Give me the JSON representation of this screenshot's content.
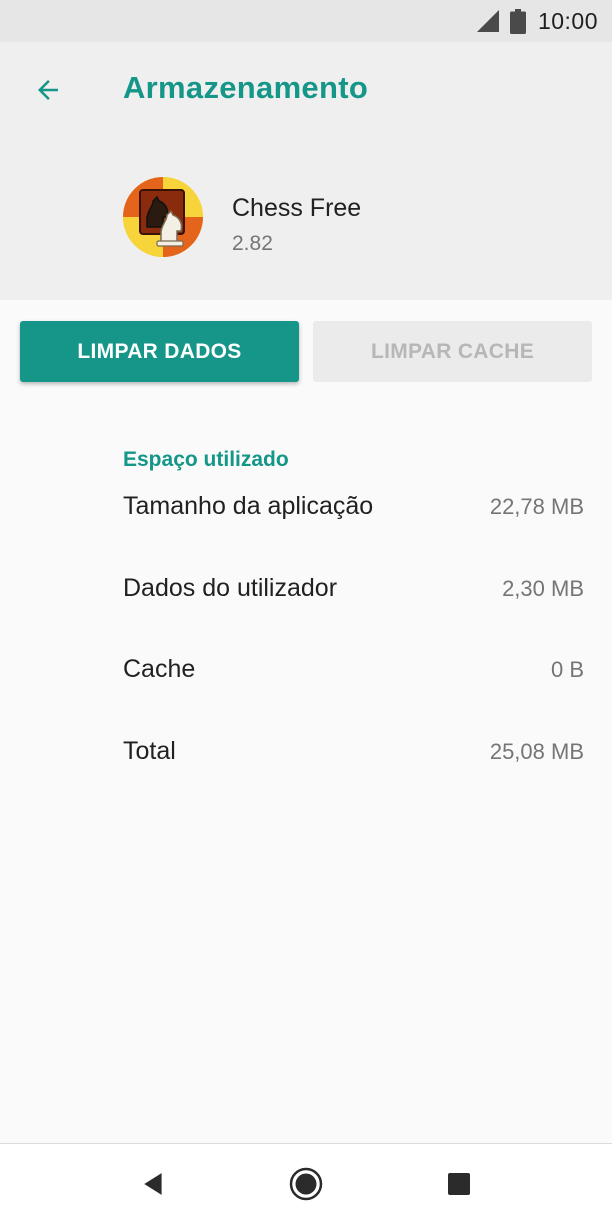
{
  "status_bar": {
    "time": "10:00",
    "icons": [
      "signal-icon",
      "battery-icon"
    ]
  },
  "header": {
    "title": "Armazenamento",
    "back_icon": "arrow-left-icon",
    "accent_color": "#149688"
  },
  "app": {
    "name": "Chess Free",
    "version": "2.82",
    "icon": "chess-knight-app-icon"
  },
  "actions": {
    "clear_data_label": "LIMPAR DADOS",
    "clear_cache_label": "LIMPAR CACHE",
    "clear_cache_enabled": false
  },
  "storage": {
    "section_title": "Espaço utilizado",
    "rows": [
      {
        "label": "Tamanho da aplicação",
        "value": "22,78 MB"
      },
      {
        "label": "Dados do utilizador",
        "value": "2,30 MB"
      },
      {
        "label": "Cache",
        "value": "0 B"
      },
      {
        "label": "Total",
        "value": "25,08 MB"
      }
    ]
  },
  "navigation": {
    "icons": [
      "back-triangle-icon",
      "home-circle-icon",
      "recents-square-icon"
    ]
  }
}
